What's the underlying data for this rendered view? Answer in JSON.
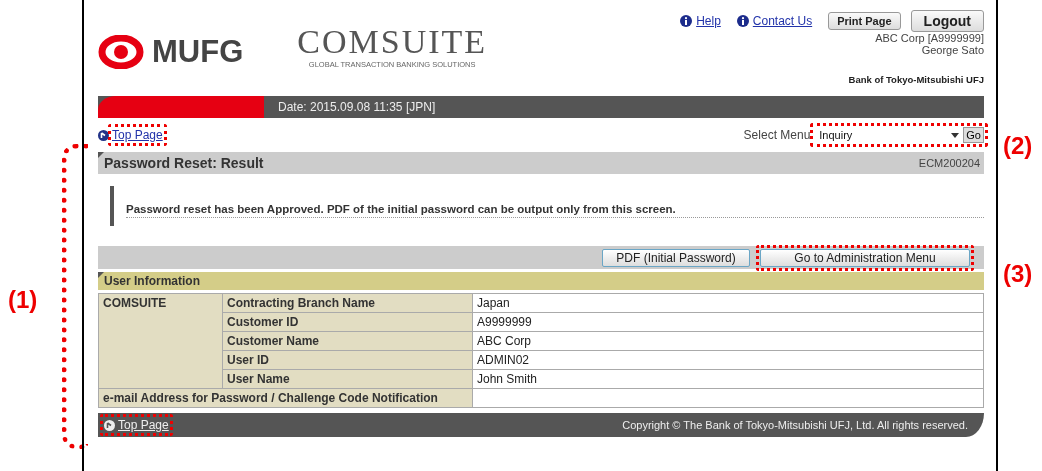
{
  "header": {
    "logo": "MUFG",
    "product": "COMSUITE",
    "tagline": "GLOBAL TRANSACTION BANKING SOLUTIONS",
    "links": [
      "Help",
      "Contact Us"
    ],
    "buttons": [
      "Print Page",
      "Logout"
    ],
    "account": "ABC Corp [A9999999]",
    "user": "George Sato",
    "bank": "Bank of Tokyo-Mitsubishi UFJ",
    "date": "Date: 2015.09.08 11:35 [JPN]"
  },
  "nav": {
    "top_link": {
      "label": "Top Page",
      "highlighted": true
    },
    "select_label": "Select Menu",
    "select": {
      "value": "Inquiry",
      "highlighted": true
    },
    "go": "Go"
  },
  "title": "Password Reset: Result",
  "screen_code": "ECM200204",
  "message": "Password reset has been Approved. PDF of the initial password can be output only from this screen.",
  "actions": [
    {
      "label": "PDF (Initial Password)",
      "highlighted": false
    },
    {
      "label": "Go to Administration Menu",
      "highlighted": true
    }
  ],
  "section": "User Information",
  "table": {
    "group": "COMSUITE",
    "rows": [
      {
        "label": "Contracting Branch Name",
        "value": "Japan"
      },
      {
        "label": "Customer ID",
        "value": "A9999999"
      },
      {
        "label": "Customer Name",
        "value": "ABC Corp"
      },
      {
        "label": "User ID",
        "value": "ADMIN02"
      },
      {
        "label": "User Name",
        "value": "John Smith"
      }
    ],
    "email_label": "e-mail Address for Password / Challenge Code Notification"
  },
  "footer": {
    "top_link": {
      "label": "Top Page",
      "highlighted": true
    },
    "copyright": "Copyright © The Bank of Tokyo-Mitsubishi UFJ, Ltd. All rights reserved."
  },
  "annotations": [
    "(1)",
    "(2)",
    "(3)"
  ]
}
